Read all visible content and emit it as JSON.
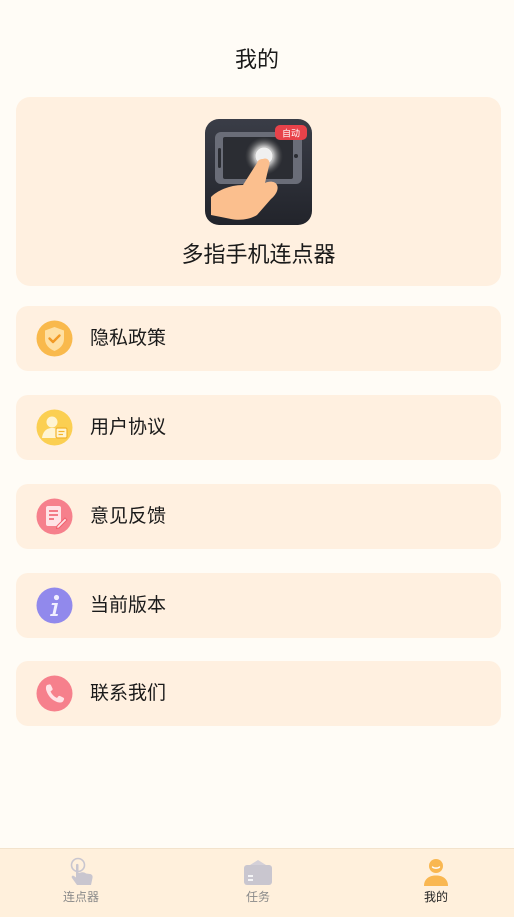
{
  "header": {
    "title": "我的"
  },
  "app": {
    "name": "多指手机连点器",
    "logo_badge": "自动"
  },
  "menu": [
    {
      "id": "privacy",
      "label": "隐私政策",
      "icon": "shield-check-icon",
      "color": "#f7a83a"
    },
    {
      "id": "agreement",
      "label": "用户协议",
      "icon": "user-card-icon",
      "color": "#f8c448"
    },
    {
      "id": "feedback",
      "label": "意见反馈",
      "icon": "edit-document-icon",
      "color": "#f4717f"
    },
    {
      "id": "version",
      "label": "当前版本",
      "icon": "info-icon",
      "color": "#8f86e8"
    },
    {
      "id": "contact",
      "label": "联系我们",
      "icon": "phone-icon",
      "color": "#f4717f"
    }
  ],
  "tabbar": {
    "tabs": [
      {
        "label": "连点器",
        "icon": "tap-hand-icon",
        "active": false
      },
      {
        "label": "任务",
        "icon": "briefcase-icon",
        "active": false
      },
      {
        "label": "我的",
        "icon": "user-profile-icon",
        "active": true
      }
    ]
  }
}
